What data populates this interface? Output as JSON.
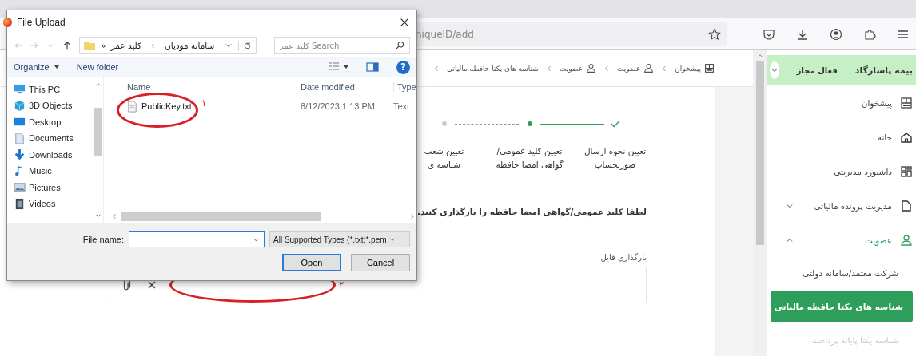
{
  "browser": {
    "url": "niqueID/add"
  },
  "dialog": {
    "title": "File Upload",
    "path": [
      "سامانه مودیان",
      "کلید عمر"
    ],
    "path_overflow": "»",
    "search": {
      "placeholder": "Search کلید عمر"
    },
    "organize": "Organize",
    "new_folder": "New folder",
    "help": "?",
    "nav_items": [
      {
        "label": "This PC"
      },
      {
        "label": "3D Objects"
      },
      {
        "label": "Desktop"
      },
      {
        "label": "Documents"
      },
      {
        "label": "Downloads"
      },
      {
        "label": "Music"
      },
      {
        "label": "Pictures"
      },
      {
        "label": "Videos"
      }
    ],
    "name_column": "Name",
    "date_column": "Date modified",
    "type_column": "Type",
    "files": [
      {
        "name": "PublicKey.txt",
        "date": "8/12/2023 1:13 PM",
        "type": "Text"
      }
    ],
    "file_name_label": "File name:",
    "filter": "All Supported Types (*.txt;*.pem",
    "open_button": {
      "label": "Open",
      "default": true
    },
    "cancel_button": {
      "label": "Cancel",
      "default": false
    }
  },
  "annotations": [
    "۱",
    "۲"
  ],
  "breadcrumb": [
    {
      "label": "پیشخوان"
    },
    {
      "label": "عضویت"
    },
    {
      "label": "عضویت"
    },
    {
      "label": "شناسه های یکتا حافظه مالیاتی"
    }
  ],
  "steps": [
    {
      "lines": [
        "تعیین نحوه ارسال",
        "صورتحساب"
      ],
      "completed": true,
      "active": false
    },
    {
      "lines": [
        "تعیین کلید عمومی/",
        "گواهی امضا حافظه"
      ],
      "completed": false,
      "active": true
    },
    {
      "lines": [
        "تعیین شعب",
        "شناسه ی"
      ],
      "completed": false,
      "active": false
    }
  ],
  "instruction": "لطفا کلید عمومی/گواهی امضا حافظه را بارگذاری کنید.",
  "upload": {
    "label": "بارگذاری فایل"
  },
  "sidebar": {
    "org": "بیمه پاسارگاد",
    "status": "فعال مجاز",
    "items": [
      {
        "label": "پیشخوان",
        "active": false
      },
      {
        "label": "خانه",
        "active": false
      },
      {
        "label": "داشبورد مدیریتی",
        "active": false
      },
      {
        "label": "مدیریت پرونده مالیاتی",
        "active": false,
        "expanded": false
      },
      {
        "label": "عضویت",
        "active": true,
        "expanded": true,
        "children": [
          {
            "label": "شرکت معتمد/سامانه دولتی",
            "selected": false,
            "disabled": false
          },
          {
            "label": "شناسه های یکتا حافظه مالیاتی",
            "selected": true,
            "disabled": false
          },
          {
            "label": "شناسه یکتا پایانه پرداخت",
            "selected": false,
            "disabled": true
          }
        ]
      }
    ]
  }
}
